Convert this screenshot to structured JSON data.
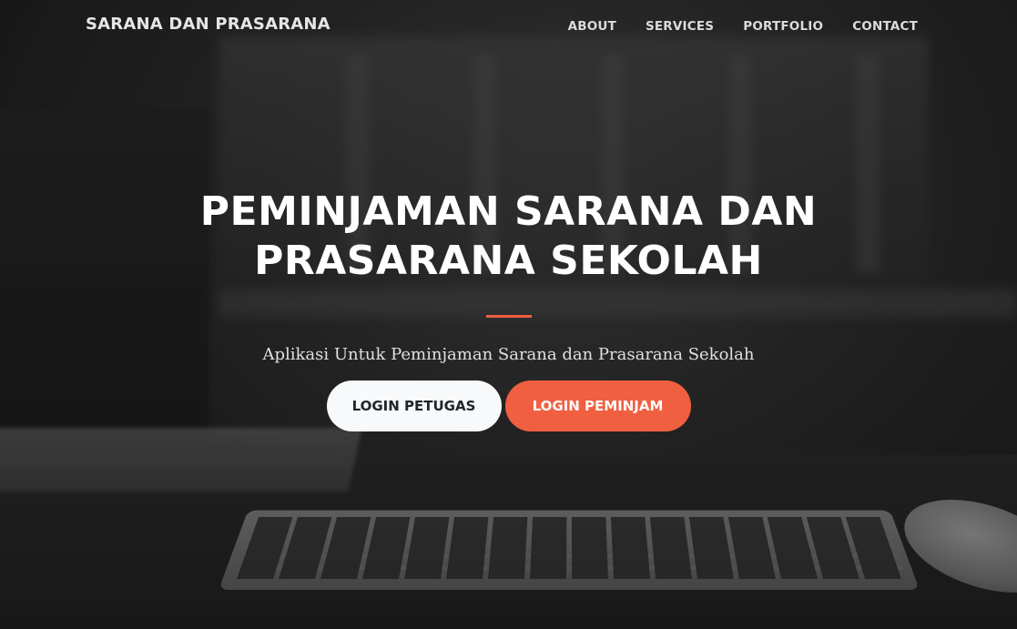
{
  "navbar": {
    "brand": "SARANA DAN PRASARANA",
    "links": [
      {
        "label": "ABOUT"
      },
      {
        "label": "SERVICES"
      },
      {
        "label": "PORTFOLIO"
      },
      {
        "label": "CONTACT"
      }
    ]
  },
  "hero": {
    "title_line1": "PEMINJAMAN SARANA DAN",
    "title_line2": "PRASARANA SEKOLAH",
    "subtitle": "Aplikasi Untuk Peminjaman Sarana dan Prasarana Sekolah",
    "buttons": {
      "login_petugas": "LOGIN PETUGAS",
      "login_peminjam": "LOGIN PEMINJAM"
    }
  },
  "colors": {
    "accent": "#f05f40",
    "light_button": "#f8f9fa"
  }
}
